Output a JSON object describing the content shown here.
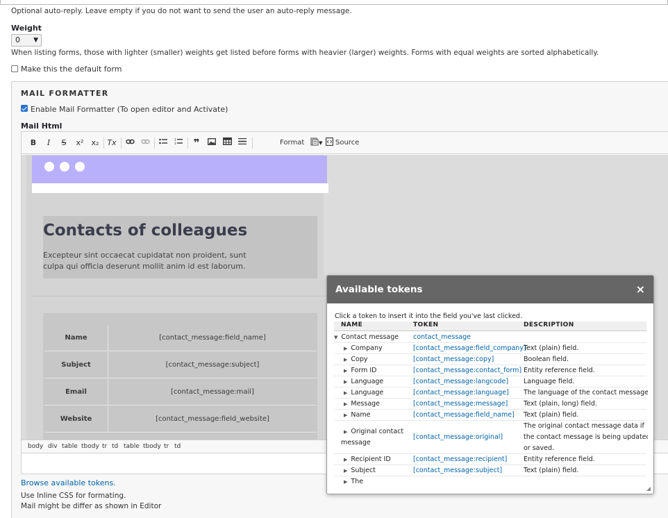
{
  "auto_reply": {
    "description": "Optional auto-reply. Leave empty if you do not want to send the user an auto-reply message."
  },
  "weight": {
    "label": "Weight",
    "value": "0",
    "description": "When listing forms, those with lighter (smaller) weights get listed before forms with heavier (larger) weights. Forms with equal weights are sorted alphabetically."
  },
  "default_form": {
    "label": "Make this the default form",
    "checked": false
  },
  "mail_formatter": {
    "legend": "MAIL FORMATTER",
    "enable_label": "Enable Mail Formatter (To open editor and Activate)",
    "enable_checked": true,
    "mail_html_label": "Mail Html"
  },
  "toolbar": {
    "bold": "B",
    "italic": "I",
    "strike": "S",
    "superscript": "x²",
    "subscript": "x₂",
    "remove_format": "Tx",
    "format_label": "Format",
    "source_label": "Source"
  },
  "email_preview": {
    "title": "Contacts of colleagues",
    "text": "Excepteur sint occaecat cupidatat non proident, sunt culpa qui officia deserunt mollit anim id est laborum.",
    "rows": [
      {
        "name": "Name",
        "value": "[contact_message:field_name]"
      },
      {
        "name": "Subject",
        "value": "[contact_message:subject]"
      },
      {
        "name": "Email",
        "value": "[contact_message:mail]"
      },
      {
        "name": "Website",
        "value": "[contact_message:field_website]"
      }
    ]
  },
  "path_bar": [
    "body",
    "div",
    "table",
    "tbody",
    "tr",
    "td",
    "table",
    "tbody",
    "tr",
    "td"
  ],
  "browse_link": "Browse available tokens.",
  "notes": {
    "inline_css": "Use Inline CSS for formating.",
    "differ": "Mail might be differ as shown in Editor"
  },
  "tokens_dialog": {
    "title": "Available tokens",
    "close": "×",
    "hint": "Click a token to insert it into the field you've last clicked.",
    "columns": {
      "name": "NAME",
      "token": "TOKEN",
      "description": "DESCRIPTION"
    },
    "group": {
      "name": "Contact message",
      "token": "contact_message"
    },
    "rows": [
      {
        "name": "Company",
        "token": "[contact_message:field_company]",
        "description": "Text (plain) field."
      },
      {
        "name": "Copy",
        "token": "[contact_message:copy]",
        "description": "Boolean field."
      },
      {
        "name": "Form ID",
        "token": "[contact_message:contact_form]",
        "description": "Entity reference field."
      },
      {
        "name": "Language",
        "token": "[contact_message:langcode]",
        "description": "Language field."
      },
      {
        "name": "Language",
        "token": "[contact_message:language]",
        "description": "The language of the contact message."
      },
      {
        "name": "Message",
        "token": "[contact_message:message]",
        "description": "Text (plain, long) field."
      },
      {
        "name": "Name",
        "token": "[contact_message:field_name]",
        "description": "Text (plain) field."
      },
      {
        "name": "Original contact",
        "name2": "message",
        "token": "[contact_message:original]",
        "description": "The original contact message data if",
        "description2": "the contact message is being updated",
        "description3": "or saved."
      },
      {
        "name": "Recipient ID",
        "token": "[contact_message:recipient]",
        "description": "Entity reference field."
      },
      {
        "name": "Subject",
        "token": "[contact_message:subject]",
        "description": "Text (plain) field."
      },
      {
        "name": "The",
        "token": "",
        "description": ""
      }
    ]
  }
}
